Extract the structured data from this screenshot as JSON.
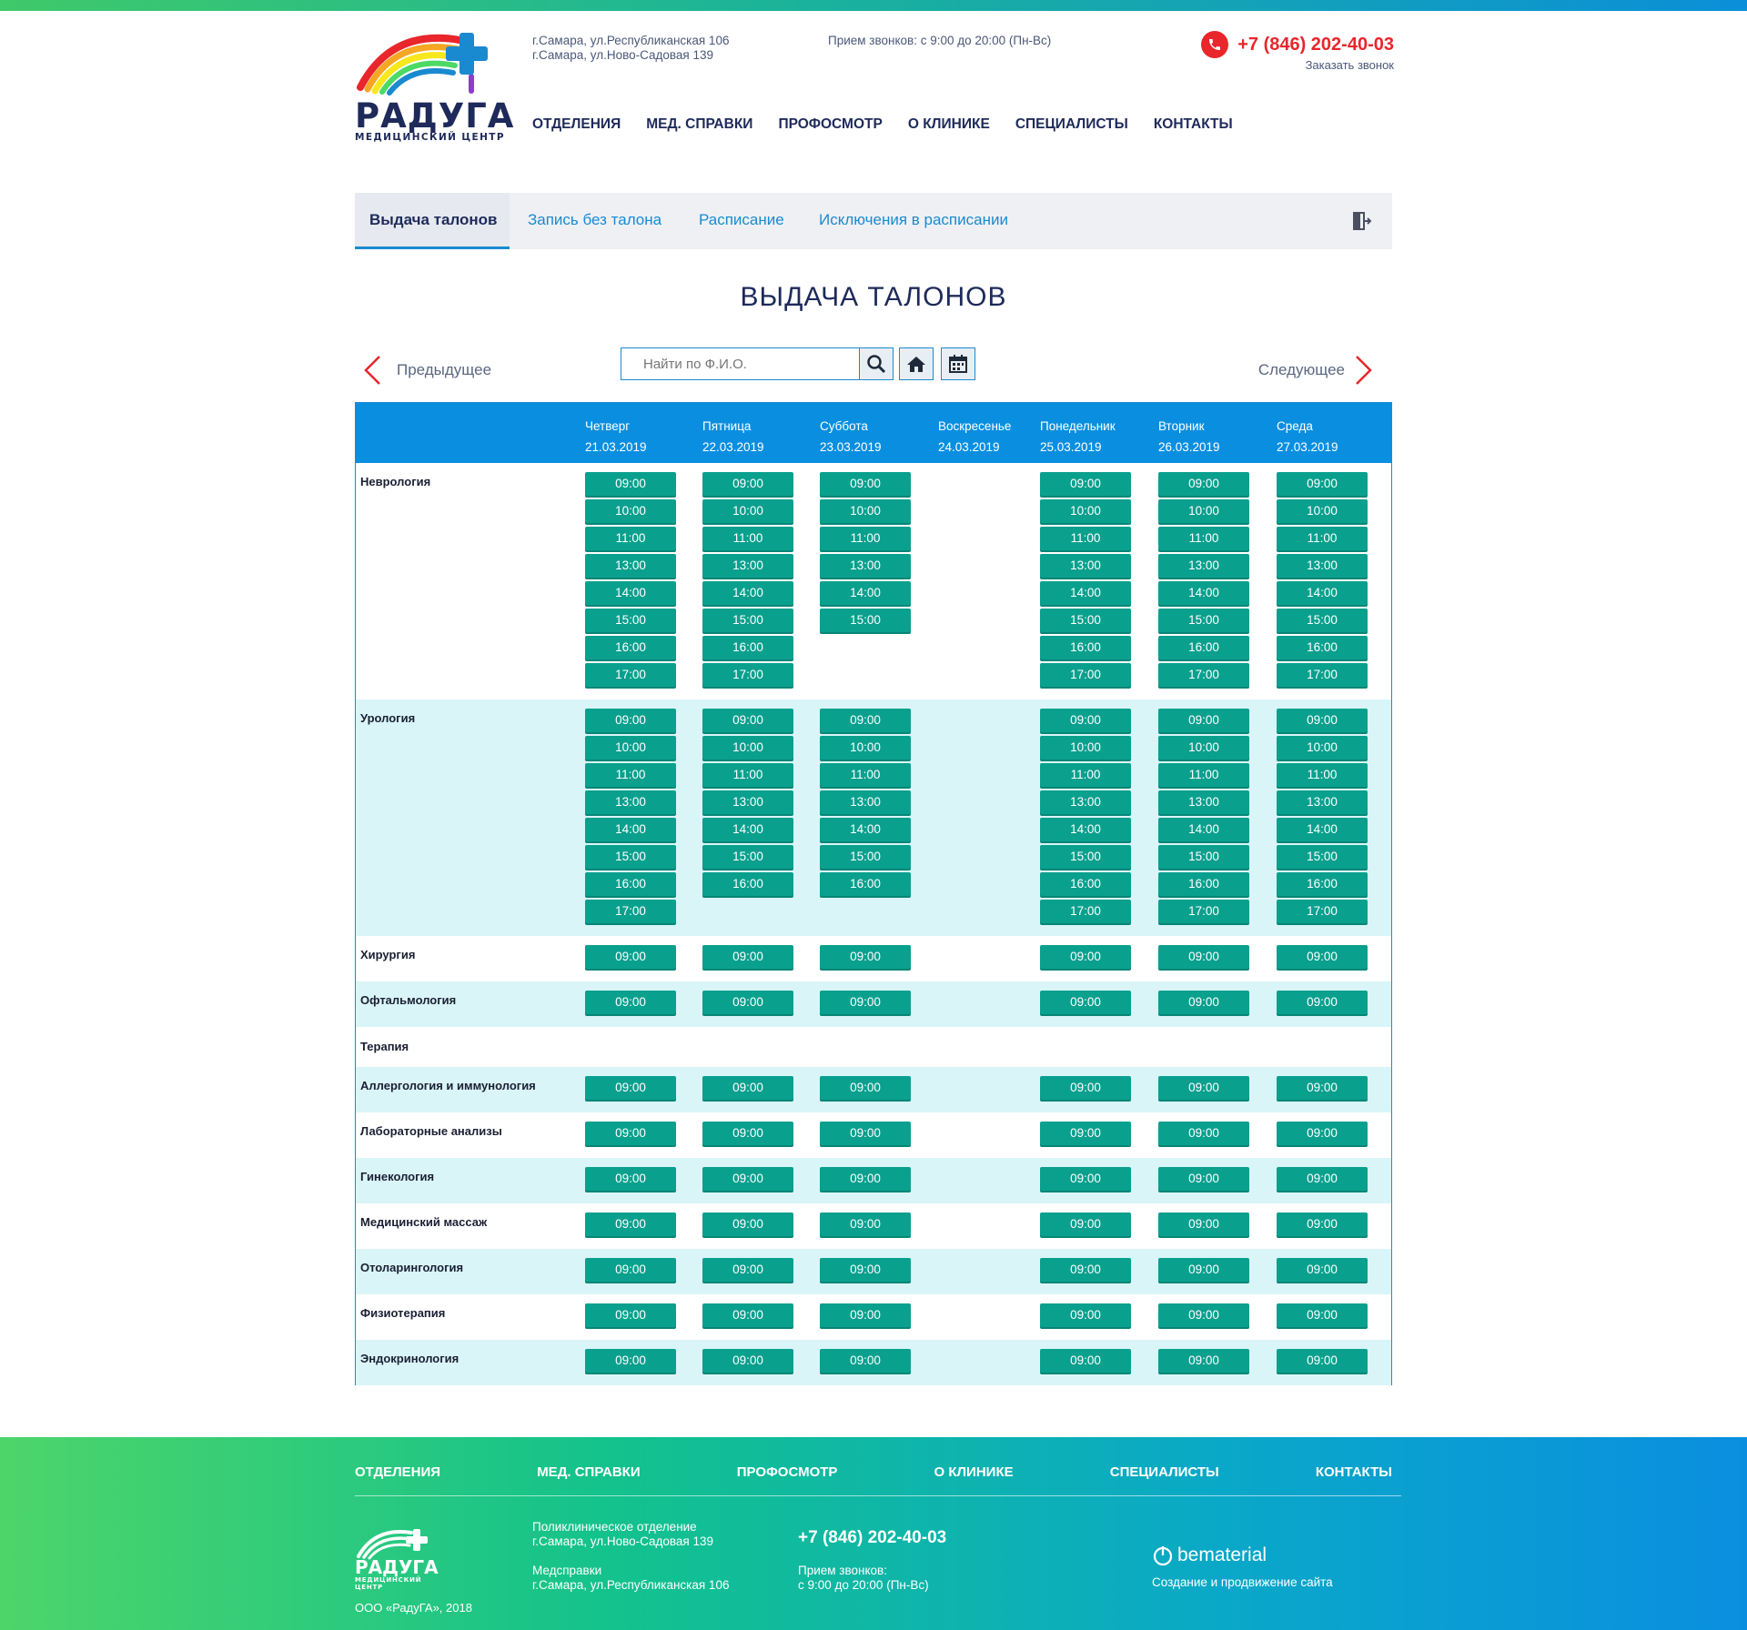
{
  "header": {
    "logo_title": "РАДУГА",
    "logo_subtitle": "МЕДИЦИНСКИЙ ЦЕНТР",
    "address_1": "г.Самара, ул.Республиканская 106",
    "address_2": "г.Самара, ул.Ново-Садовая 139",
    "hours": "Прием звонков: с 9:00 до 20:00 (Пн-Вс)",
    "phone": "+7 (846) 202-40-03",
    "callback": "Заказать звонок",
    "nav": [
      "ОТДЕЛЕНИЯ",
      "МЕД. СПРАВКИ",
      "ПРОФОСМОТР",
      "О КЛИНИКЕ",
      "СПЕЦИАЛИСТЫ",
      "КОНТАКТЫ"
    ]
  },
  "tabs": [
    {
      "label": "Выдача талонов",
      "active": true
    },
    {
      "label": "Запись без талона",
      "active": false
    },
    {
      "label": "Расписание",
      "active": false
    },
    {
      "label": "Исключения в расписании",
      "active": false
    }
  ],
  "page_title": "ВЫДАЧА ТАЛОНОВ",
  "controls": {
    "prev": "Предыдущее",
    "next": "Следующее",
    "search_placeholder": "Найти по Ф.И.О."
  },
  "days": [
    {
      "name": "Четверг",
      "date": "21.03.2019"
    },
    {
      "name": "Пятница",
      "date": "22.03.2019"
    },
    {
      "name": "Суббота",
      "date": "23.03.2019"
    },
    {
      "name": "Воскресенье",
      "date": "24.03.2019"
    },
    {
      "name": "Понедельник",
      "date": "25.03.2019"
    },
    {
      "name": "Вторник",
      "date": "26.03.2019"
    },
    {
      "name": "Среда",
      "date": "27.03.2019"
    }
  ],
  "departments": [
    {
      "name": "Неврология",
      "slots": [
        [
          "09:00",
          "10:00",
          "11:00",
          "13:00",
          "14:00",
          "15:00",
          "16:00",
          "17:00"
        ],
        [
          "09:00",
          "10:00",
          "11:00",
          "13:00",
          "14:00",
          "15:00",
          "16:00",
          "17:00"
        ],
        [
          "09:00",
          "10:00",
          "11:00",
          "13:00",
          "14:00",
          "15:00"
        ],
        [],
        [
          "09:00",
          "10:00",
          "11:00",
          "13:00",
          "14:00",
          "15:00",
          "16:00",
          "17:00"
        ],
        [
          "09:00",
          "10:00",
          "11:00",
          "13:00",
          "14:00",
          "15:00",
          "16:00",
          "17:00"
        ],
        [
          "09:00",
          "10:00",
          "11:00",
          "13:00",
          "14:00",
          "15:00",
          "16:00",
          "17:00"
        ]
      ]
    },
    {
      "name": "Урология",
      "slots": [
        [
          "09:00",
          "10:00",
          "11:00",
          "13:00",
          "14:00",
          "15:00",
          "16:00",
          "17:00"
        ],
        [
          "09:00",
          "10:00",
          "11:00",
          "13:00",
          "14:00",
          "15:00",
          "16:00"
        ],
        [
          "09:00",
          "10:00",
          "11:00",
          "13:00",
          "14:00",
          "15:00",
          "16:00"
        ],
        [],
        [
          "09:00",
          "10:00",
          "11:00",
          "13:00",
          "14:00",
          "15:00",
          "16:00",
          "17:00"
        ],
        [
          "09:00",
          "10:00",
          "11:00",
          "13:00",
          "14:00",
          "15:00",
          "16:00",
          "17:00"
        ],
        [
          "09:00",
          "10:00",
          "11:00",
          "13:00",
          "14:00",
          "15:00",
          "16:00",
          "17:00"
        ]
      ]
    },
    {
      "name": "Хирургия",
      "slots": [
        [
          "09:00"
        ],
        [
          "09:00"
        ],
        [
          "09:00"
        ],
        [],
        [
          "09:00"
        ],
        [
          "09:00"
        ],
        [
          "09:00"
        ]
      ]
    },
    {
      "name": "Офтальмология",
      "slots": [
        [
          "09:00"
        ],
        [
          "09:00"
        ],
        [
          "09:00"
        ],
        [],
        [
          "09:00"
        ],
        [
          "09:00"
        ],
        [
          "09:00"
        ]
      ]
    },
    {
      "name": "Терапия",
      "slots": [
        [],
        [],
        [],
        [],
        [],
        [],
        []
      ]
    },
    {
      "name": "Аллергология и иммунология",
      "slots": [
        [
          "09:00"
        ],
        [
          "09:00"
        ],
        [
          "09:00"
        ],
        [],
        [
          "09:00"
        ],
        [
          "09:00"
        ],
        [
          "09:00"
        ]
      ]
    },
    {
      "name": "Лабораторные анализы",
      "slots": [
        [
          "09:00"
        ],
        [
          "09:00"
        ],
        [
          "09:00"
        ],
        [],
        [
          "09:00"
        ],
        [
          "09:00"
        ],
        [
          "09:00"
        ]
      ]
    },
    {
      "name": "Гинекология",
      "slots": [
        [
          "09:00"
        ],
        [
          "09:00"
        ],
        [
          "09:00"
        ],
        [],
        [
          "09:00"
        ],
        [
          "09:00"
        ],
        [
          "09:00"
        ]
      ]
    },
    {
      "name": "Медицинский массаж",
      "slots": [
        [
          "09:00"
        ],
        [
          "09:00"
        ],
        [
          "09:00"
        ],
        [],
        [
          "09:00"
        ],
        [
          "09:00"
        ],
        [
          "09:00"
        ]
      ]
    },
    {
      "name": "Отоларингология",
      "slots": [
        [
          "09:00"
        ],
        [
          "09:00"
        ],
        [
          "09:00"
        ],
        [],
        [
          "09:00"
        ],
        [
          "09:00"
        ],
        [
          "09:00"
        ]
      ]
    },
    {
      "name": "Физиотерапия",
      "slots": [
        [
          "09:00"
        ],
        [
          "09:00"
        ],
        [
          "09:00"
        ],
        [],
        [
          "09:00"
        ],
        [
          "09:00"
        ],
        [
          "09:00"
        ]
      ]
    },
    {
      "name": "Эндокринология",
      "slots": [
        [
          "09:00"
        ],
        [
          "09:00"
        ],
        [
          "09:00"
        ],
        [],
        [
          "09:00"
        ],
        [
          "09:00"
        ],
        [
          "09:00"
        ]
      ]
    }
  ],
  "footer": {
    "nav": [
      "ОТДЕЛЕНИЯ",
      "МЕД. СПРАВКИ",
      "ПРОФОСМОТР",
      "О КЛИНИКЕ",
      "СПЕЦИАЛИСТЫ",
      "КОНТАКТЫ"
    ],
    "logo_title": "РАДУГА",
    "logo_subtitle": "МЕДИЦИНСКИЙ ЦЕНТР",
    "copyright": "ООО «РадуГА», 2018",
    "clinic_label": "Поликлиническое отделение",
    "clinic_address": "г.Самара, ул.Ново-Садовая 139",
    "certs_label": "Медсправки",
    "certs_address": "г.Самара, ул.Республиканская 106",
    "phone": "+7 (846) 202-40-03",
    "hours_label": "Прием звонков:",
    "hours": "с 9:00 до 20:00 (Пн-Вс)",
    "dev_brand": "bematerial",
    "dev_caption": "Создание и продвижение сайта"
  },
  "colors": {
    "accent": "#0a8fe0",
    "slot": "#0aa08e",
    "row_alt": "#d9f5f8",
    "phone": "#e8262c",
    "brand_dark": "#1e2a5a"
  }
}
